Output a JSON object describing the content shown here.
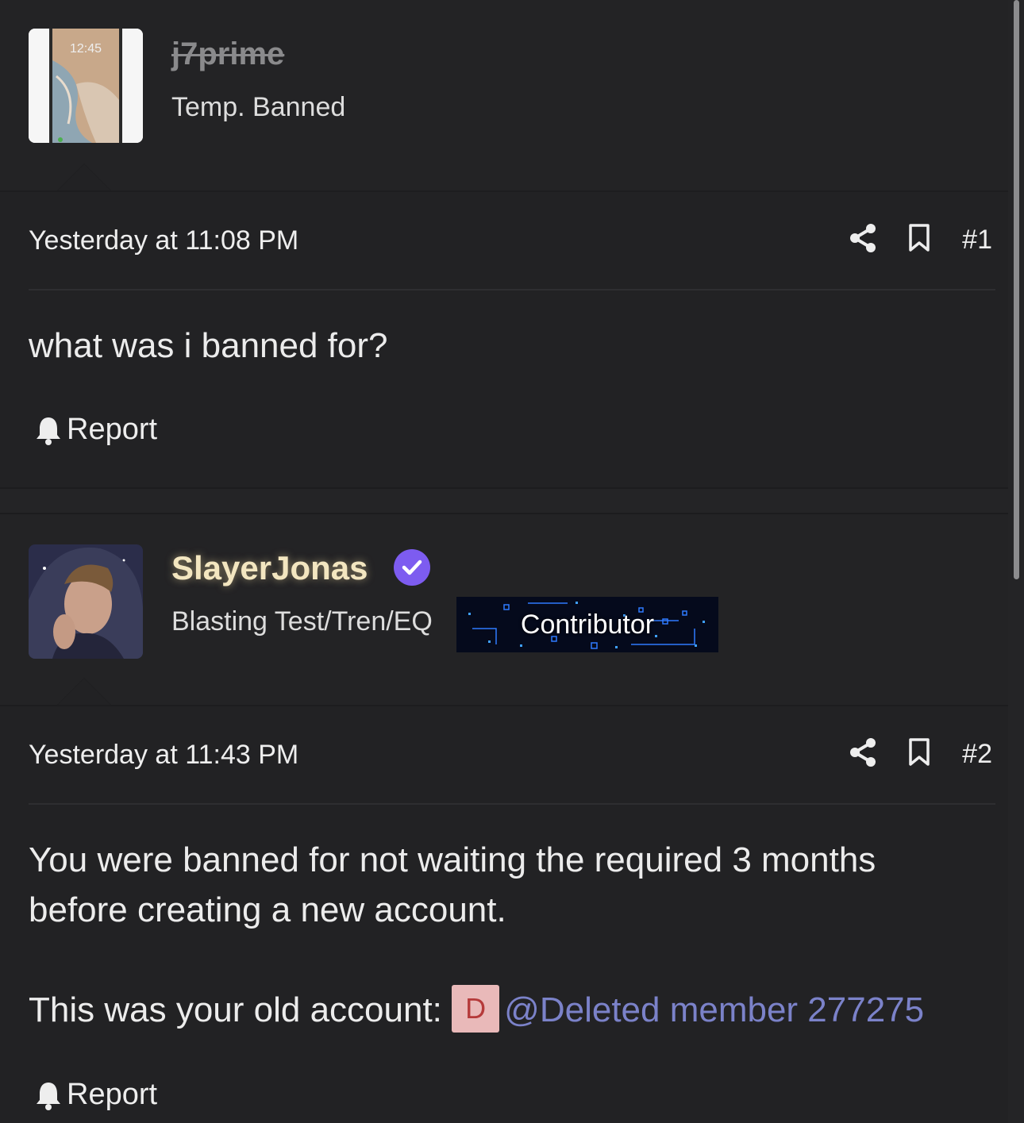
{
  "posts": [
    {
      "username": "j7prime",
      "user_title": "Temp. Banned",
      "avatar_time": "12:45",
      "timestamp": "Yesterday at 11:08 PM",
      "post_number": "#1",
      "body_lines": [
        "what was i banned for?"
      ],
      "report_label": "Report"
    },
    {
      "username": "SlayerJonas",
      "user_title": "Blasting Test/Tren/EQ",
      "badge": "Contributor",
      "timestamp": "Yesterday at 11:43 PM",
      "post_number": "#2",
      "body_lines": [
        "You were banned for not waiting the required 3 months",
        "before creating a new account."
      ],
      "old_account_prefix": "This was your old account:",
      "mention_avatar_letter": "D",
      "mention_text": "@Deleted member 277275",
      "report_label": "Report"
    }
  ],
  "icons": {
    "share": "share-icon",
    "bookmark": "bookmark-icon",
    "report": "bell-icon",
    "verified": "verified-check-icon"
  },
  "colors": {
    "background": "#242426",
    "verified": "#7d5cf0",
    "mention_link": "#7b82c9",
    "username_glow": "#f3e6c0",
    "banned_username": "#8a8a8c"
  }
}
